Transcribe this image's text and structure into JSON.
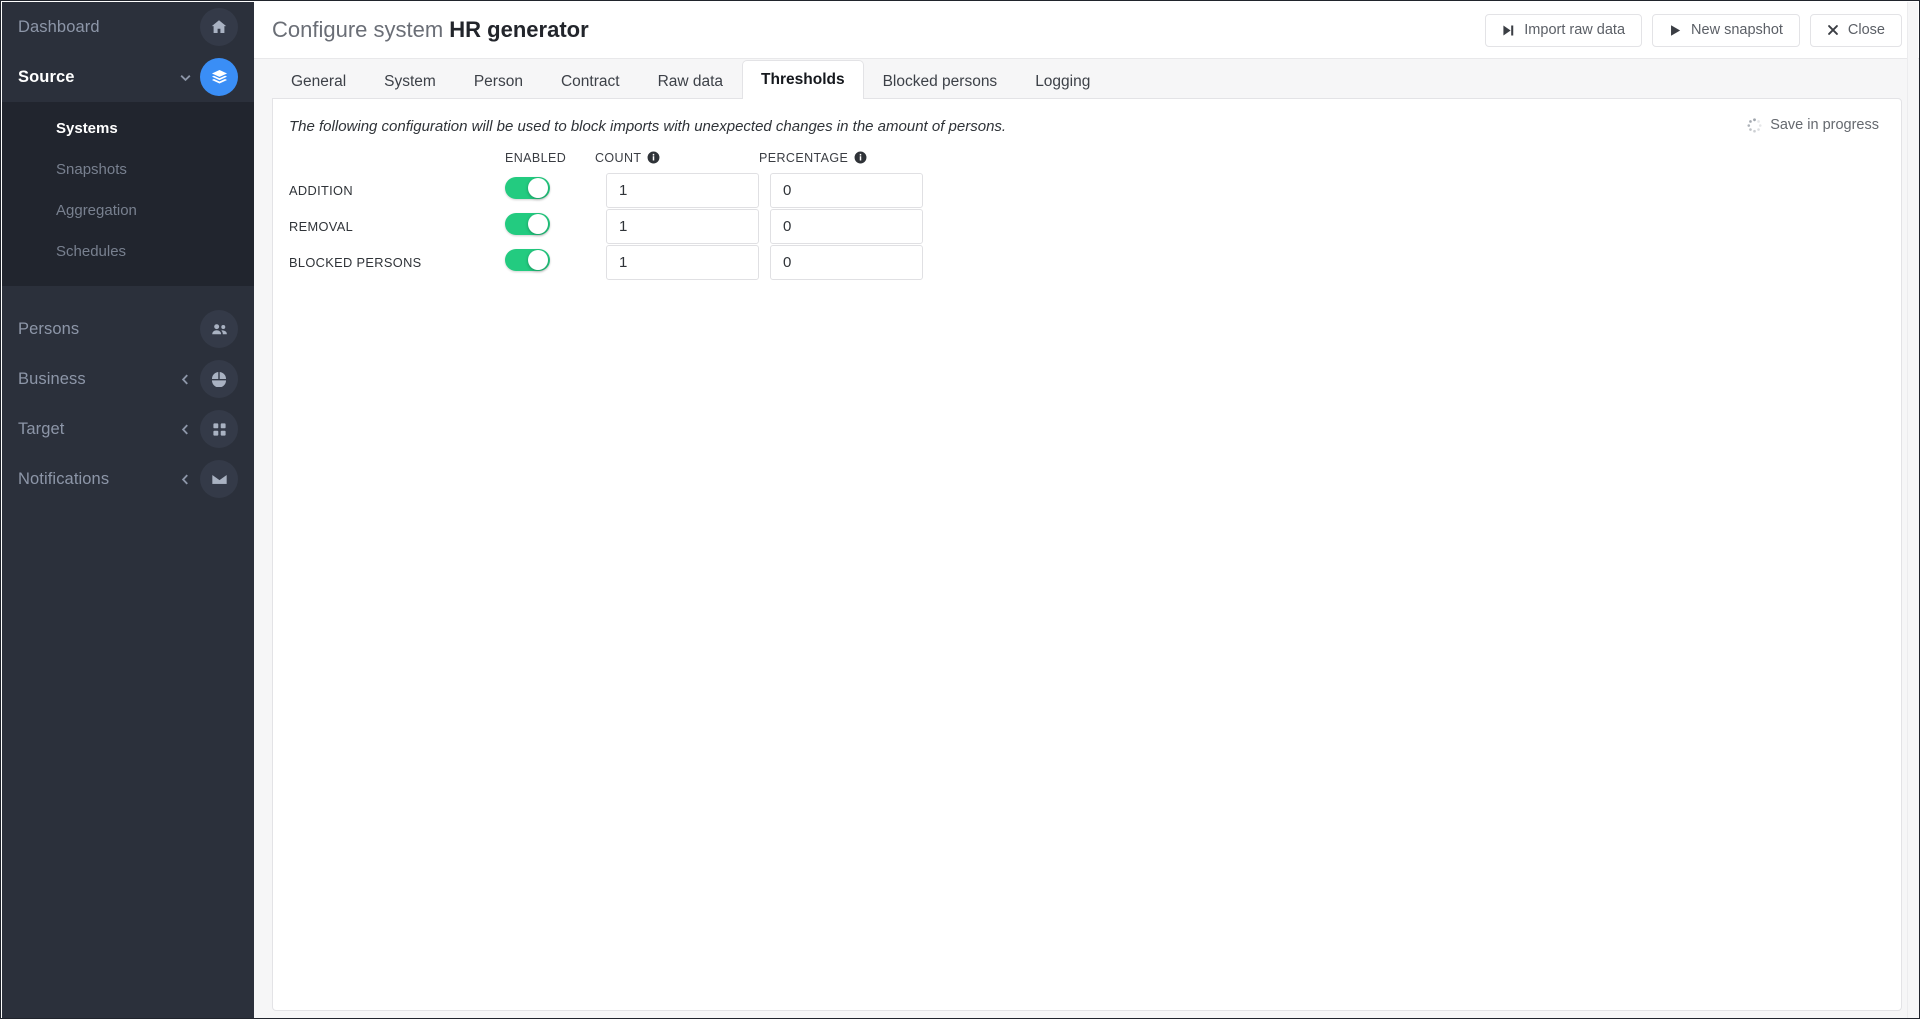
{
  "sidebar": {
    "items": [
      {
        "label": "Dashboard",
        "icon": "home-icon",
        "active": false,
        "has_caret": false,
        "accent": false
      },
      {
        "label": "Source",
        "icon": "layers-icon",
        "active": true,
        "has_caret": true,
        "caret": "chevron-down-icon",
        "accent": true
      }
    ],
    "submenu": [
      {
        "label": "Systems",
        "active": true
      },
      {
        "label": "Snapshots",
        "active": false
      },
      {
        "label": "Aggregation",
        "active": false
      },
      {
        "label": "Schedules",
        "active": false
      }
    ],
    "items_lower": [
      {
        "label": "Persons",
        "icon": "people-icon",
        "has_caret": false
      },
      {
        "label": "Business",
        "icon": "pie-chart-icon",
        "has_caret": true,
        "caret": "chevron-left-icon"
      },
      {
        "label": "Target",
        "icon": "grid-icon",
        "has_caret": true,
        "caret": "chevron-left-icon"
      },
      {
        "label": "Notifications",
        "icon": "envelope-icon",
        "has_caret": true,
        "caret": "chevron-left-icon"
      }
    ]
  },
  "header": {
    "title_prefix": "Configure system ",
    "title_strong": "HR generator",
    "buttons": [
      {
        "label": "Import raw data",
        "icon": "step-forward-icon"
      },
      {
        "label": "New snapshot",
        "icon": "play-icon"
      },
      {
        "label": "Close",
        "icon": "close-x-icon"
      }
    ]
  },
  "tabs": [
    {
      "label": "General",
      "selected": false
    },
    {
      "label": "System",
      "selected": false
    },
    {
      "label": "Person",
      "selected": false
    },
    {
      "label": "Contract",
      "selected": false
    },
    {
      "label": "Raw data",
      "selected": false
    },
    {
      "label": "Thresholds",
      "selected": true
    },
    {
      "label": "Blocked persons",
      "selected": false
    },
    {
      "label": "Logging",
      "selected": false
    }
  ],
  "panel": {
    "description": "The following configuration will be used to block imports with unexpected changes in the amount of persons.",
    "save_status": "Save in progress",
    "save_status_icon": "spinner-icon",
    "table": {
      "headers": [
        {
          "label": "",
          "info": false
        },
        {
          "label": "ENABLED",
          "info": false
        },
        {
          "label": "COUNT",
          "info": true
        },
        {
          "label": "PERCENTAGE",
          "info": true
        }
      ],
      "rows": [
        {
          "name": "ADDITION",
          "enabled": true,
          "count": "1",
          "percentage": "0"
        },
        {
          "name": "REMOVAL",
          "enabled": true,
          "count": "1",
          "percentage": "0"
        },
        {
          "name": "BLOCKED PERSONS",
          "enabled": true,
          "count": "1",
          "percentage": "0"
        }
      ]
    }
  },
  "colors": {
    "sidebar_bg": "#2b303b",
    "submenu_bg": "#21252e",
    "accent_blue": "#3a8ef6",
    "toggle_green": "#23cb80",
    "page_bg": "#f6f6f7"
  }
}
